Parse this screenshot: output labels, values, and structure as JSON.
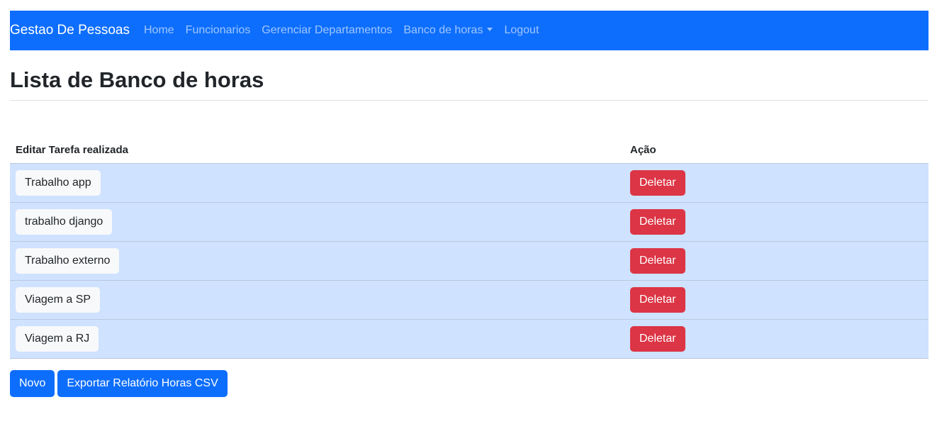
{
  "navbar": {
    "brand": "Gestao De Pessoas",
    "links": [
      "Home",
      "Funcionarios",
      "Gerenciar Departamentos",
      "Banco de horas",
      "Logout"
    ]
  },
  "page": {
    "title": "Lista de Banco de horas"
  },
  "table": {
    "headers": [
      "Editar Tarefa realizada",
      "Ação"
    ],
    "rows": [
      {
        "task": "Trabalho app",
        "action": "Deletar"
      },
      {
        "task": "trabalho django",
        "action": "Deletar"
      },
      {
        "task": "Trabalho externo",
        "action": "Deletar"
      },
      {
        "task": "Viagem a SP",
        "action": "Deletar"
      },
      {
        "task": "Viagem a RJ",
        "action": "Deletar"
      }
    ]
  },
  "footer": {
    "new_label": "Novo",
    "export_label": "Exportar Relatório Horas CSV"
  },
  "colors": {
    "primary": "#0d6efd",
    "danger": "#dc3545",
    "row_bg": "#cfe2ff",
    "light": "#f8f9fa"
  }
}
